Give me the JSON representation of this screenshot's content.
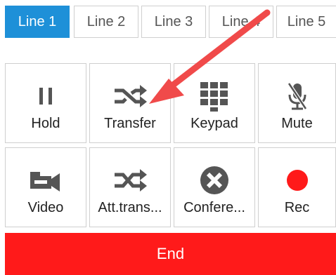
{
  "tabs": [
    {
      "label": "Line 1",
      "active": true
    },
    {
      "label": "Line 2",
      "active": false
    },
    {
      "label": "Line 3",
      "active": false
    },
    {
      "label": "Line 4",
      "active": false
    },
    {
      "label": "Line 5",
      "active": false
    }
  ],
  "buttons": {
    "hold": {
      "label": "Hold",
      "icon": "pause-icon"
    },
    "transfer": {
      "label": "Transfer",
      "icon": "transfer-icon"
    },
    "keypad": {
      "label": "Keypad",
      "icon": "keypad-icon"
    },
    "mute": {
      "label": "Mute",
      "icon": "mic-muted-icon"
    },
    "video": {
      "label": "Video",
      "icon": "video-camera-icon"
    },
    "att_transfer": {
      "label": "Att.trans...",
      "icon": "attended-transfer-icon"
    },
    "conference": {
      "label": "Confere...",
      "icon": "conference-icon"
    },
    "rec": {
      "label": "Rec",
      "icon": "record-icon"
    }
  },
  "end_label": "End",
  "colors": {
    "active_tab": "#1e90d8",
    "end_button": "#ff1a1a",
    "record_dot": "#ff1a1a",
    "icon_gray": "#555555",
    "annotation_arrow": "#f04a4a"
  }
}
